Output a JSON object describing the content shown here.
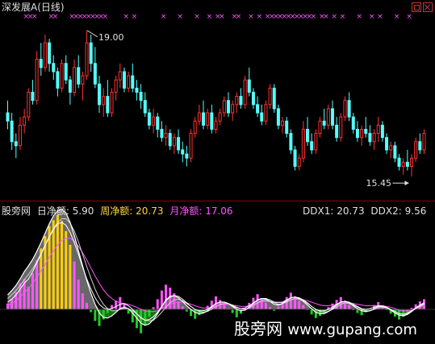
{
  "title": {
    "name": "深发展A",
    "period": "(日线)"
  },
  "indicator": {
    "name": "股旁网",
    "daily_label": "日净额:",
    "daily_value": "5.90",
    "weekly_label": "周净额:",
    "weekly_value": "20.73",
    "monthly_label": "月净额:",
    "monthly_value": "17.06",
    "ddx1_label": "DDX1:",
    "ddx1_value": "20.73",
    "ddx2_label": "DDX2:",
    "ddx2_value": "9.56"
  },
  "watermark": {
    "cn": "股旁网",
    "url": "www.gupang.com"
  },
  "colors": {
    "up": "#ff3232",
    "down": "#55ffff",
    "magenta": "#ff55ff",
    "green": "#22cc22",
    "yellow": "#ffd000",
    "gray": "#7a7a7a",
    "white": "#ffffff",
    "text": "#e0e0e0",
    "weekly": "#ffd24a",
    "monthly": "#ff55ff"
  },
  "icons": [
    "restore-icon",
    "close-icon"
  ],
  "chart_data": [
    {
      "type": "candlestick",
      "annotations": [
        {
          "text": "19.00",
          "kind": "high"
        },
        {
          "text": "15.45",
          "kind": "low"
        }
      ],
      "ohlc": [
        [
          17.0,
          17.3,
          16.6,
          16.8
        ],
        [
          16.8,
          17.0,
          16.1,
          16.3
        ],
        [
          16.3,
          16.5,
          15.9,
          16.2
        ],
        [
          16.2,
          16.9,
          16.1,
          16.7
        ],
        [
          16.7,
          17.1,
          16.5,
          16.9
        ],
        [
          16.9,
          17.6,
          16.8,
          17.5
        ],
        [
          17.5,
          17.8,
          17.2,
          17.3
        ],
        [
          17.3,
          18.5,
          17.2,
          18.3
        ],
        [
          18.3,
          18.7,
          17.9,
          18.1
        ],
        [
          18.1,
          18.9,
          18.0,
          18.7
        ],
        [
          18.7,
          18.8,
          18.0,
          18.2
        ],
        [
          18.2,
          18.4,
          17.8,
          18.0
        ],
        [
          18.0,
          18.1,
          17.4,
          17.6
        ],
        [
          17.6,
          18.3,
          17.5,
          18.2
        ],
        [
          18.2,
          18.4,
          17.7,
          17.8
        ],
        [
          17.8,
          17.9,
          17.2,
          17.5
        ],
        [
          17.5,
          18.3,
          17.4,
          18.1
        ],
        [
          18.1,
          18.4,
          17.6,
          17.7
        ],
        [
          17.7,
          18.0,
          17.3,
          17.9
        ],
        [
          17.9,
          19.0,
          17.8,
          18.7
        ],
        [
          18.7,
          18.9,
          18.0,
          18.2
        ],
        [
          18.2,
          18.6,
          17.6,
          17.7
        ],
        [
          17.7,
          17.9,
          17.0,
          17.2
        ],
        [
          17.2,
          17.6,
          16.9,
          17.4
        ],
        [
          17.4,
          17.8,
          16.9,
          17.0
        ],
        [
          17.0,
          17.6,
          16.9,
          17.5
        ],
        [
          17.5,
          17.9,
          17.3,
          17.8
        ],
        [
          17.8,
          18.2,
          17.6,
          18.0
        ],
        [
          18.0,
          18.1,
          17.5,
          17.6
        ],
        [
          17.6,
          18.0,
          17.5,
          17.9
        ],
        [
          17.9,
          18.2,
          17.5,
          17.6
        ],
        [
          17.6,
          17.8,
          17.3,
          17.5
        ],
        [
          17.5,
          17.7,
          17.1,
          17.3
        ],
        [
          17.3,
          17.5,
          16.9,
          17.0
        ],
        [
          17.0,
          17.1,
          16.6,
          16.7
        ],
        [
          16.7,
          17.1,
          16.5,
          16.9
        ],
        [
          16.9,
          17.0,
          16.4,
          16.6
        ],
        [
          16.6,
          16.8,
          16.3,
          16.4
        ],
        [
          16.4,
          16.7,
          16.2,
          16.5
        ],
        [
          16.5,
          16.6,
          16.1,
          16.2
        ],
        [
          16.2,
          16.5,
          16.0,
          16.4
        ],
        [
          16.4,
          16.6,
          16.0,
          16.1
        ],
        [
          16.1,
          16.3,
          15.8,
          16.0
        ],
        [
          16.0,
          16.2,
          15.7,
          15.9
        ],
        [
          15.9,
          16.6,
          15.8,
          16.5
        ],
        [
          16.5,
          16.9,
          16.4,
          16.8
        ],
        [
          16.8,
          17.2,
          16.7,
          17.0
        ],
        [
          17.0,
          17.3,
          16.6,
          16.7
        ],
        [
          16.7,
          17.1,
          16.6,
          17.0
        ],
        [
          17.0,
          17.2,
          16.5,
          16.6
        ],
        [
          16.6,
          16.9,
          16.5,
          16.8
        ],
        [
          16.8,
          17.1,
          16.7,
          17.0
        ],
        [
          17.0,
          17.4,
          16.9,
          17.3
        ],
        [
          17.3,
          17.5,
          16.9,
          17.0
        ],
        [
          17.0,
          17.3,
          16.8,
          17.2
        ],
        [
          17.2,
          17.5,
          17.0,
          17.4
        ],
        [
          17.4,
          17.6,
          17.1,
          17.2
        ],
        [
          17.2,
          17.9,
          17.1,
          17.8
        ],
        [
          17.8,
          18.1,
          17.4,
          17.5
        ],
        [
          17.5,
          17.6,
          17.1,
          17.2
        ],
        [
          17.2,
          17.4,
          16.9,
          17.0
        ],
        [
          17.0,
          17.2,
          16.7,
          16.8
        ],
        [
          16.8,
          17.3,
          16.7,
          17.2
        ],
        [
          17.2,
          17.7,
          17.1,
          17.6
        ],
        [
          17.6,
          17.7,
          17.0,
          17.1
        ],
        [
          17.1,
          17.2,
          16.6,
          16.7
        ],
        [
          16.7,
          16.9,
          16.5,
          16.8
        ],
        [
          16.8,
          16.9,
          16.4,
          16.5
        ],
        [
          16.5,
          16.6,
          16.0,
          16.1
        ],
        [
          16.1,
          16.2,
          15.6,
          15.7
        ],
        [
          15.7,
          16.0,
          15.6,
          15.9
        ],
        [
          15.9,
          16.8,
          15.8,
          16.6
        ],
        [
          16.6,
          16.9,
          16.2,
          16.3
        ],
        [
          16.3,
          16.5,
          16.0,
          16.1
        ],
        [
          16.1,
          16.6,
          16.0,
          16.5
        ],
        [
          16.5,
          16.9,
          16.4,
          16.8
        ],
        [
          16.8,
          17.1,
          16.6,
          16.7
        ],
        [
          16.7,
          17.2,
          16.6,
          17.1
        ],
        [
          17.1,
          17.3,
          16.6,
          16.7
        ],
        [
          16.7,
          16.9,
          16.3,
          16.4
        ],
        [
          16.4,
          17.0,
          16.3,
          16.9
        ],
        [
          16.9,
          17.4,
          16.8,
          17.3
        ],
        [
          17.3,
          17.5,
          16.8,
          16.9
        ],
        [
          16.9,
          17.0,
          16.5,
          16.6
        ],
        [
          16.6,
          16.8,
          16.3,
          16.4
        ],
        [
          16.4,
          16.7,
          16.2,
          16.6
        ],
        [
          16.6,
          16.9,
          16.4,
          16.5
        ],
        [
          16.5,
          16.7,
          16.2,
          16.3
        ],
        [
          16.3,
          16.6,
          16.1,
          16.5
        ],
        [
          16.5,
          16.9,
          16.3,
          16.7
        ],
        [
          16.7,
          16.8,
          16.3,
          16.4
        ],
        [
          16.4,
          16.5,
          16.0,
          16.1
        ],
        [
          16.1,
          16.3,
          15.9,
          16.2
        ],
        [
          16.2,
          16.3,
          15.8,
          15.9
        ],
        [
          15.9,
          16.0,
          15.6,
          15.7
        ],
        [
          15.7,
          15.9,
          15.5,
          15.8
        ],
        [
          15.8,
          16.1,
          15.6,
          15.7
        ],
        [
          15.7,
          16.0,
          15.45,
          15.9
        ],
        [
          15.9,
          16.4,
          15.8,
          16.3
        ],
        [
          16.3,
          16.5,
          16.0,
          16.1
        ],
        [
          16.1,
          16.6,
          16.0,
          16.5
        ]
      ],
      "signal_marks": [
        4,
        5,
        6,
        10,
        11,
        15,
        16,
        17,
        18,
        19,
        20,
        21,
        22,
        23,
        28,
        30,
        37,
        41,
        45,
        48,
        50,
        51,
        54,
        55,
        58,
        60,
        62,
        63,
        64,
        65,
        66,
        67,
        68,
        69,
        70,
        71,
        72,
        73,
        75,
        76,
        78,
        80,
        84,
        87,
        89,
        93,
        96
      ]
    },
    {
      "type": "bar+line",
      "series": [
        {
          "name": "日净额",
          "values": [
            0.8,
            1.5,
            2.4,
            3.6,
            4.2,
            3.1,
            5.0,
            6.8,
            8.4,
            10.1,
            11.5,
            12.3,
            13.0,
            12.2,
            10.8,
            8.9,
            6.6,
            4.1,
            2.2,
            0.9,
            -0.4,
            -1.6,
            -2.3,
            -1.4,
            -0.5,
            0.6,
            1.2,
            1.7,
            0.8,
            -0.6,
            -1.8,
            -2.6,
            -3.3,
            -2.2,
            -1.0,
            0.3,
            1.4,
            2.6,
            3.4,
            3.0,
            2.2,
            1.1,
            0.4,
            -0.3,
            -0.9,
            -1.3,
            -0.8,
            -0.2,
            0.5,
            1.2,
            1.8,
            1.3,
            0.7,
            0.1,
            -0.5,
            -1.1,
            -0.6,
            0.2,
            0.9,
            1.6,
            2.1,
            1.5,
            0.9,
            0.3,
            -0.2,
            0.4,
            1.0,
            1.7,
            2.3,
            1.8,
            1.2,
            0.6,
            -0.1,
            -0.7,
            -1.2,
            -0.9,
            -0.4,
            0.3,
            0.8,
            1.3,
            1.7,
            1.2,
            0.6,
            0.0,
            -0.5,
            -0.8,
            -0.4,
            0.1,
            0.6,
            1.0,
            0.5,
            -0.1,
            -0.6,
            -1.0,
            -1.4,
            -1.0,
            -0.4,
            0.2,
            0.7,
            1.1,
            1.4
          ]
        },
        {
          "name": "DDX1",
          "values": [
            2.0,
            2.6,
            3.3,
            4.2,
            5.2,
            6.0,
            6.9,
            8.0,
            9.2,
            10.5,
            11.8,
            12.9,
            13.6,
            13.8,
            13.3,
            12.0,
            10.2,
            8.1,
            6.0,
            4.0,
            2.2,
            0.7,
            -0.5,
            -1.1,
            -1.2,
            -0.9,
            -0.4,
            0.1,
            0.3,
            0.1,
            -0.5,
            -1.2,
            -1.9,
            -2.2,
            -2.0,
            -1.4,
            -0.6,
            0.4,
            1.3,
            1.8,
            1.9,
            1.6,
            1.1,
            0.5,
            0.0,
            -0.4,
            -0.6,
            -0.5,
            -0.2,
            0.3,
            0.8,
            1.0,
            1.0,
            0.8,
            0.4,
            0.0,
            -0.2,
            -0.1,
            0.3,
            0.8,
            1.3,
            1.5,
            1.4,
            1.1,
            0.7,
            0.6,
            0.8,
            1.2,
            1.6,
            1.7,
            1.5,
            1.1,
            0.6,
            0.1,
            -0.4,
            -0.6,
            -0.6,
            -0.3,
            0.1,
            0.6,
            1.0,
            1.1,
            0.9,
            0.5,
            0.1,
            -0.2,
            -0.3,
            -0.2,
            0.1,
            0.4,
            0.4,
            0.2,
            -0.1,
            -0.5,
            -0.8,
            -0.9,
            -0.7,
            -0.3,
            0.2,
            0.6,
            0.9
          ]
        },
        {
          "name": "DDX2",
          "values": [
            1.5,
            2.0,
            2.6,
            3.3,
            4.1,
            4.8,
            5.6,
            6.6,
            7.7,
            8.9,
            10.1,
            11.2,
            12.0,
            12.5,
            12.5,
            11.9,
            10.8,
            9.3,
            7.6,
            5.9,
            4.3,
            2.8,
            1.6,
            0.7,
            0.1,
            -0.2,
            -0.2,
            0.0,
            0.1,
            0.1,
            -0.2,
            -0.6,
            -1.1,
            -1.5,
            -1.6,
            -1.5,
            -1.0,
            -0.4,
            0.3,
            0.9,
            1.3,
            1.4,
            1.2,
            0.8,
            0.4,
            0.0,
            -0.3,
            -0.4,
            -0.3,
            0.0,
            0.4,
            0.7,
            0.8,
            0.8,
            0.6,
            0.3,
            0.1,
            0.0,
            0.2,
            0.5,
            0.9,
            1.2,
            1.2,
            1.1,
            0.9,
            0.7,
            0.8,
            1.0,
            1.3,
            1.5,
            1.4,
            1.2,
            0.8,
            0.4,
            0.0,
            -0.3,
            -0.4,
            -0.3,
            0.0,
            0.3,
            0.7,
            0.9,
            0.8,
            0.6,
            0.3,
            0.0,
            -0.2,
            -0.2,
            0.0,
            0.2,
            0.3,
            0.2,
            0.0,
            -0.3,
            -0.6,
            -0.7,
            -0.6,
            -0.3,
            0.1,
            0.4,
            0.7
          ]
        },
        {
          "name": "周净额",
          "values": [
            1.0,
            1.4,
            2.0,
            2.8,
            3.6,
            4.2,
            5.2,
            6.4,
            7.6,
            8.8,
            10.0,
            11.0,
            11.8,
            12.0,
            11.6,
            10.6,
            9.2,
            7.6,
            5.8,
            4.2,
            2.8,
            1.6,
            0.7,
            0.2,
            0.0,
            0.1,
            0.4,
            0.7,
            0.8,
            0.5,
            0.0,
            -0.6,
            -1.2,
            -1.5,
            -1.4,
            -1.0,
            -0.4,
            0.4,
            1.2,
            1.7,
            1.9,
            1.8,
            1.4,
            0.9,
            0.4,
            0.0,
            -0.2,
            -0.2,
            0.0,
            0.4,
            0.8,
            1.0,
            1.0,
            0.8,
            0.5,
            0.2,
            0.1,
            0.2,
            0.5,
            0.9,
            1.3,
            1.5,
            1.5,
            1.3,
            1.0,
            0.9,
            1.0,
            1.3,
            1.6,
            1.7,
            1.6,
            1.3,
            0.9,
            0.4,
            0.0,
            -0.2,
            -0.2,
            0.0,
            0.3,
            0.7,
            1.0,
            1.1,
            1.0,
            0.7,
            0.4,
            0.1,
            0.0,
            0.1,
            0.3,
            0.5,
            0.5,
            0.3,
            0.0,
            -0.3,
            -0.6,
            -0.7,
            -0.5,
            -0.2,
            0.2,
            0.5,
            0.8
          ]
        },
        {
          "name": "月净额",
          "values": [
            0.5,
            0.8,
            1.2,
            1.7,
            2.3,
            2.9,
            3.6,
            4.4,
            5.3,
            6.2,
            7.2,
            8.1,
            8.9,
            9.5,
            9.8,
            9.8,
            9.4,
            8.7,
            7.8,
            6.8,
            5.7,
            4.6,
            3.6,
            2.7,
            2.0,
            1.5,
            1.1,
            0.9,
            0.8,
            0.7,
            0.5,
            0.3,
            0.0,
            -0.2,
            -0.3,
            -0.3,
            -0.2,
            0.1,
            0.4,
            0.7,
            0.9,
            1.0,
            1.0,
            0.9,
            0.7,
            0.5,
            0.3,
            0.2,
            0.2,
            0.3,
            0.5,
            0.6,
            0.7,
            0.7,
            0.6,
            0.5,
            0.4,
            0.4,
            0.5,
            0.7,
            0.9,
            1.0,
            1.1,
            1.1,
            1.0,
            1.0,
            1.0,
            1.1,
            1.3,
            1.4,
            1.4,
            1.3,
            1.2,
            1.0,
            0.8,
            0.6,
            0.5,
            0.5,
            0.6,
            0.7,
            0.8,
            0.9,
            0.9,
            0.8,
            0.7,
            0.6,
            0.5,
            0.5,
            0.5,
            0.5,
            0.5,
            0.4,
            0.3,
            0.1,
            -0.1,
            -0.2,
            -0.2,
            -0.1,
            0.1,
            0.3,
            0.5
          ]
        }
      ]
    }
  ]
}
